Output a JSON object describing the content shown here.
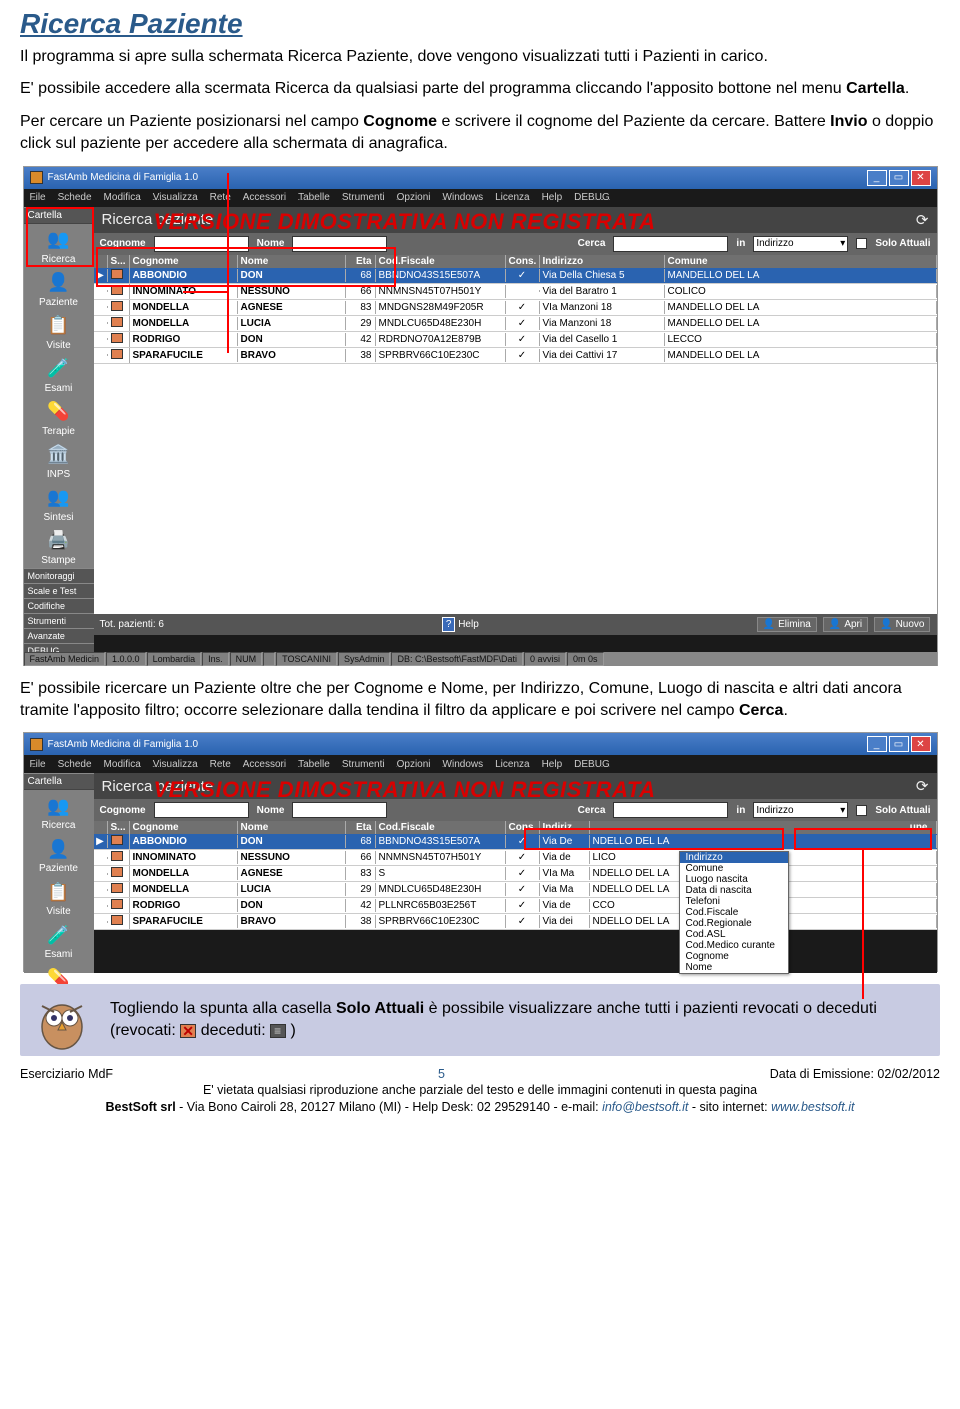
{
  "doc": {
    "title": "Ricerca Paziente",
    "p1": "Il programma si apre sulla schermata Ricerca Paziente, dove vengono visualizzati tutti i Pazienti in carico.",
    "p2a": "E' possibile accedere alla scermata Ricerca da qualsiasi parte del programma cliccando l'apposito bottone nel menu ",
    "p2b": "Cartella",
    "p2c": ".",
    "p3a": "Per cercare un Paziente posizionarsi nel campo ",
    "p3b": "Cognome",
    "p3c": " e scrivere il cognome del Paziente da cercare. Battere ",
    "p3d": "Invio",
    "p3e": " o doppio click sul paziente per accedere alla schermata di anagrafica.",
    "p4a": "E' possibile ricercare un Paziente oltre che per Cognome e Nome, per Indirizzo, Comune, Luogo di nascita e altri dati ancora tramite l'apposito filtro; occorre selezionare dalla tendina il filtro da applicare e poi scrivere nel campo ",
    "p4b": "Cerca",
    "p4c": ".",
    "callout_a": "Togliendo la spunta alla casella ",
    "callout_b": "Solo Attuali",
    "callout_c": " è possibile visualizzare anche tutti i pazienti revocati o deceduti (revocati: ",
    "callout_d": "  deceduti: ",
    "callout_e": "  )"
  },
  "app": {
    "caption": "FastAmb Medicina di Famiglia 1.0",
    "menus": [
      "File",
      "Schede",
      "Modifica",
      "Visualizza",
      "Rete",
      "Accessori",
      "Tabelle",
      "Strumenti",
      "Opzioni",
      "Windows",
      "Licenza",
      "Help",
      "DEBUG"
    ],
    "demo": "VERSIONE DIMOSTRATIVA NON REGISTRATA",
    "sidebar": {
      "cartella": "Cartella",
      "items": [
        {
          "label": "Ricerca",
          "icon": "👥"
        },
        {
          "label": "Paziente",
          "icon": "👤"
        },
        {
          "label": "Visite",
          "icon": "📋"
        },
        {
          "label": "Esami",
          "icon": "🧪"
        },
        {
          "label": "Terapie",
          "icon": "💊"
        },
        {
          "label": "INPS",
          "icon": "🏛️"
        },
        {
          "label": "Sintesi",
          "icon": "👥"
        },
        {
          "label": "Stampe",
          "icon": "🖨️"
        }
      ],
      "mini": [
        "Monitoraggi",
        "Scale e Test",
        "Codifiche",
        "Strumenti",
        "Avanzate",
        "DEBUG"
      ]
    },
    "mainTitle": "Ricerca paziente",
    "search": {
      "cognome": "Cognome",
      "nome": "Nome",
      "cerca": "Cerca",
      "in": "in",
      "select": "Indirizzo",
      "solo": "Solo Attuali"
    },
    "columns": {
      "s": "S...",
      "cog": "Cognome",
      "nome": "Nome",
      "eta": "Eta",
      "cf": "Cod.Fiscale",
      "cons": "Cons.",
      "ind": "Indirizzo",
      "com": "Comune"
    },
    "rows1": [
      {
        "cog": "ABBONDIO",
        "nome": "DON",
        "eta": "68",
        "cf": "BBNDNO43S15E507A",
        "cons": "✓",
        "ind": "Via Della Chiesa 5",
        "com": "MANDELLO DEL LA"
      },
      {
        "cog": "INNOMINATO",
        "nome": "NESSUNO",
        "eta": "66",
        "cf": "NNMNSN45T07H501Y",
        "cons": "",
        "ind": "Via del Baratro 1",
        "com": "COLICO"
      },
      {
        "cog": "MONDELLA",
        "nome": "AGNESE",
        "eta": "83",
        "cf": "MNDGNS28M49F205R",
        "cons": "✓",
        "ind": "VIa Manzoni 18",
        "com": "MANDELLO DEL LA"
      },
      {
        "cog": "MONDELLA",
        "nome": "LUCIA",
        "eta": "29",
        "cf": "MNDLCU65D48E230H",
        "cons": "✓",
        "ind": "Via Manzoni 18",
        "com": "MANDELLO DEL LA"
      },
      {
        "cog": "RODRIGO",
        "nome": "DON",
        "eta": "42",
        "cf": "RDRDNO70A12E879B",
        "cons": "✓",
        "ind": "Via del Casello 1",
        "com": "LECCO"
      },
      {
        "cog": "SPARAFUCILE",
        "nome": "BRAVO",
        "eta": "38",
        "cf": "SPRBRV66C10E230C",
        "cons": "✓",
        "ind": "Via dei Cattivi 17",
        "com": "MANDELLO DEL LA"
      }
    ],
    "rows2": [
      {
        "cog": "ABBONDIO",
        "nome": "DON",
        "eta": "68",
        "cf": "BBNDNO43S15E507A",
        "cons": "✓",
        "ind": "Via De",
        "com": "NDELLO DEL LA"
      },
      {
        "cog": "INNOMINATO",
        "nome": "NESSUNO",
        "eta": "66",
        "cf": "NNMNSN45T07H501Y",
        "cons": "✓",
        "ind": "Via de",
        "com": "LICO"
      },
      {
        "cog": "MONDELLA",
        "nome": "AGNESE",
        "eta": "83",
        "cf": "S",
        "cons": "✓",
        "ind": "VIa Ma",
        "com": "NDELLO DEL LA"
      },
      {
        "cog": "MONDELLA",
        "nome": "LUCIA",
        "eta": "29",
        "cf": "MNDLCU65D48E230H",
        "cons": "✓",
        "ind": "Via Ma",
        "com": "NDELLO DEL LA"
      },
      {
        "cog": "RODRIGO",
        "nome": "DON",
        "eta": "42",
        "cf": "PLLNRC65B03E256T",
        "cons": "✓",
        "ind": "Via de",
        "com": "CCO"
      },
      {
        "cog": "SPARAFUCILE",
        "nome": "BRAVO",
        "eta": "38",
        "cf": "SPRBRV66C10E230C",
        "cons": "✓",
        "ind": "Via dei",
        "com": "NDELLO DEL LA"
      }
    ],
    "dropdown": [
      "Indirizzo",
      "Comune",
      "Luogo nascita",
      "Data di nascita",
      "Telefoni",
      "Cod.Fiscale",
      "Cod.Regionale",
      "Cod.ASL",
      "Cod.Medico curante",
      "Cognome",
      "Nome"
    ],
    "tot": "Tot. pazienti: 6",
    "help": "Help",
    "elimina": "Elimina",
    "apri": "Apri",
    "nuovo": "Nuovo",
    "status": [
      "FastAmb Medicin",
      "1.0.0.0",
      "Lombardia",
      "Ins.",
      "NUM",
      "",
      "TOSCANINI",
      "SysAdmin",
      "DB: C:\\Bestsoft\\FastMDF\\Dati",
      "0 avvisi",
      "0m 0s"
    ]
  },
  "footer": {
    "left": "Eserciziario MdF",
    "pnum": "5",
    "right": "Data di Emissione: 02/02/2012",
    "l2": "E' vietata qualsiasi riproduzione anche parziale del testo e delle immagini contenuti in questa pagina",
    "l3a": "BestSoft srl",
    "l3b": " - Via Bono Cairoli 28, 20127 Milano (MI) - Help Desk: 02 29529140 - e-mail: ",
    "l3c": "info@bestsoft.it",
    "l3d": " - sito internet: ",
    "l3e": "www.bestsoft.it"
  }
}
